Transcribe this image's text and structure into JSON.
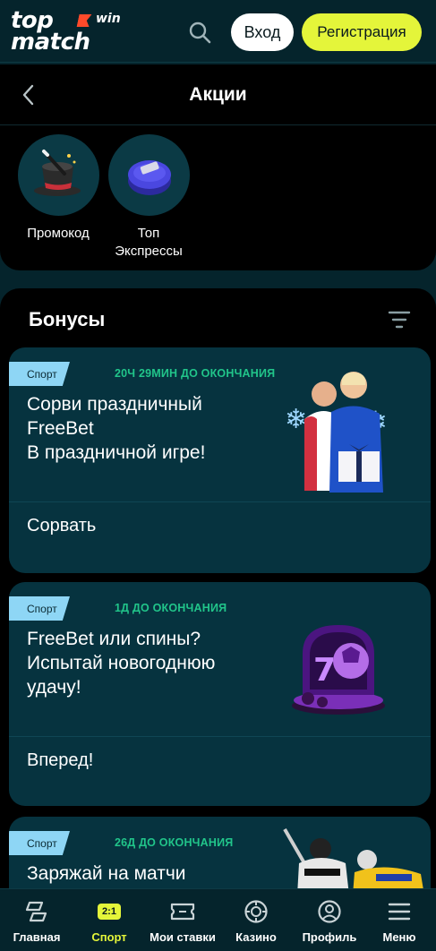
{
  "header": {
    "logo_top": "top",
    "logo_bottom": "match",
    "logo_win": "win",
    "login_label": "Вход",
    "register_label": "Регистрация",
    "colors": {
      "accent": "#e4f53a",
      "background": "#05242c"
    }
  },
  "promo": {
    "title": "Акции",
    "stories": [
      {
        "label": "Промокод",
        "icon": "magic-hat-icon"
      },
      {
        "label": "Топ Экспрессы",
        "icon": "ticket-stack-icon"
      }
    ]
  },
  "bonuses": {
    "title": "Бонусы",
    "cards": [
      {
        "tag": "Спорт",
        "timer": "20Ч 29МИН ДО ОКОНЧАНИЯ",
        "title_lines": [
          "Сорви праздничный",
          "FreeBet",
          "В праздничной игре!"
        ],
        "action": "Сорвать"
      },
      {
        "tag": "Спорт",
        "timer": "1Д ДО ОКОНЧАНИЯ",
        "title_lines": [
          "FreeBet или спины?",
          "Испытай новогоднюю",
          "удачу!"
        ],
        "action": "Вперед!"
      },
      {
        "tag": "Спорт",
        "timer": "26Д ДО ОКОНЧАНИЯ",
        "title_lines": [
          "Заряжай на матчи"
        ],
        "action": ""
      }
    ]
  },
  "nav": {
    "items": [
      {
        "label": "Главная",
        "icon": "home-icon"
      },
      {
        "label": "Спорт",
        "icon": "sport-badge-icon",
        "badge": "2:1",
        "active": true
      },
      {
        "label": "Мои ставки",
        "icon": "ticket-icon"
      },
      {
        "label": "Казино",
        "icon": "casino-chip-icon"
      },
      {
        "label": "Профиль",
        "icon": "profile-icon"
      },
      {
        "label": "Меню",
        "icon": "menu-icon"
      }
    ]
  }
}
